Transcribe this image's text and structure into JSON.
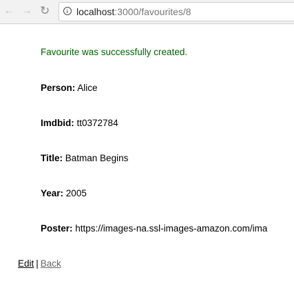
{
  "browser": {
    "url_host": "localhost",
    "url_path": ":3000/favourites/8",
    "icons": [
      "back-arrow-icon",
      "forward-arrow-icon",
      "reload-icon",
      "info-icon"
    ]
  },
  "notice": "Favourite was successfully created.",
  "fields": [
    {
      "label": "Person:",
      "value": "Alice"
    },
    {
      "label": "Imdbid:",
      "value": "tt0372784"
    },
    {
      "label": "Title:",
      "value": "Batman Begins"
    },
    {
      "label": "Year:",
      "value": "2005"
    },
    {
      "label": "Poster:",
      "value": "https://images-na.ssl-images-amazon.com/ima"
    }
  ],
  "links": {
    "edit": "Edit",
    "separator": "|",
    "back": "Back"
  },
  "colors": {
    "notice": "#006400",
    "back_link": "#666666"
  }
}
